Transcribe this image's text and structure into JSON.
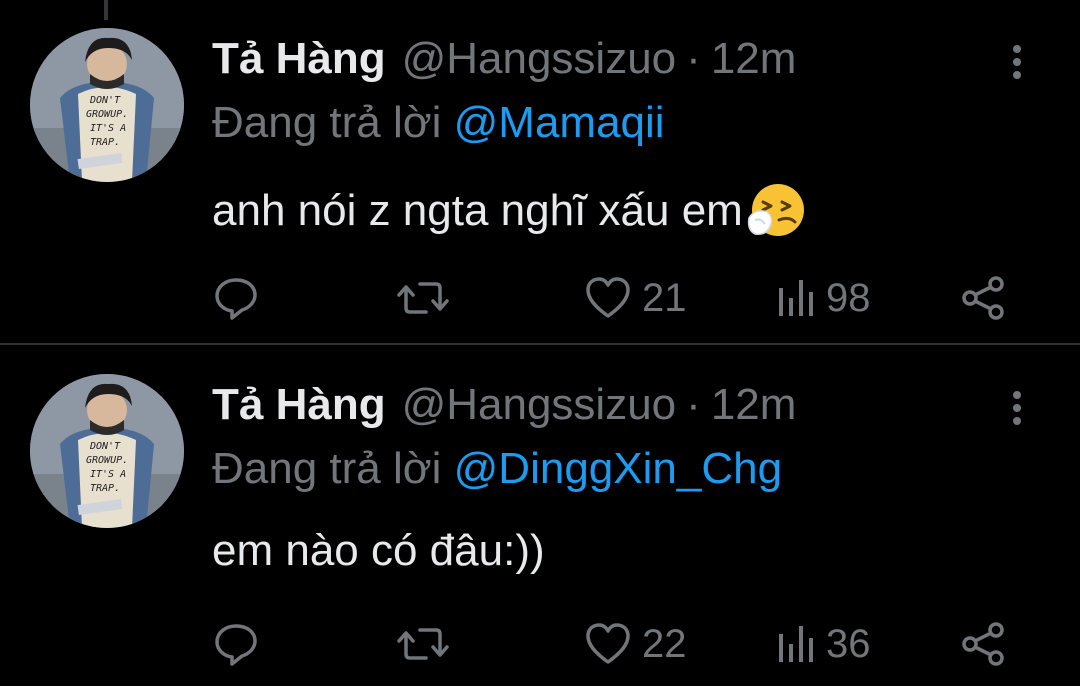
{
  "colors": {
    "background": "#000000",
    "primary_text": "#e7e9ea",
    "secondary_text": "#71767b",
    "link": "#1d9bf0",
    "divider": "#2f3336"
  },
  "tweets": [
    {
      "display_name": "Tả Hàng",
      "handle": "@Hangssizuo",
      "separator": "·",
      "time": "12m",
      "replying_prefix": "Đang trả lời",
      "replying_to": "@Mamaqii",
      "text": "anh nói z ngta nghĩ xấu em",
      "emoji": "sneezing-face",
      "likes": "21",
      "views": "98",
      "avatar_shirt_text": [
        "DON'T",
        "GROWUP.",
        "IT'S A",
        "TRAP."
      ]
    },
    {
      "display_name": "Tả Hàng",
      "handle": "@Hangssizuo",
      "separator": "·",
      "time": "12m",
      "replying_prefix": "Đang trả lời",
      "replying_to": "@DinggXin_Chg",
      "text": "em nào có đâu:))",
      "emoji": "",
      "likes": "22",
      "views": "36",
      "avatar_shirt_text": [
        "DON'T",
        "GROWUP.",
        "IT'S A",
        "TRAP."
      ]
    }
  ],
  "icons": {
    "reply": "reply-icon",
    "retweet": "retweet-icon",
    "like": "like-icon",
    "views": "views-icon",
    "share": "share-icon",
    "more": "more-icon"
  }
}
